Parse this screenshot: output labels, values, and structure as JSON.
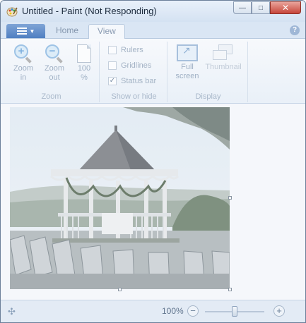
{
  "window": {
    "title": "Untitled - Paint (Not Responding)",
    "close_label": "✕",
    "maximize_label": "□",
    "minimize_label": "—"
  },
  "ribbon": {
    "tabs": [
      {
        "label": "Home",
        "active": false
      },
      {
        "label": "View",
        "active": true
      }
    ],
    "help_label": "?",
    "zoom_group": {
      "label": "Zoom",
      "zoom_in": {
        "line1": "Zoom",
        "line2": "in",
        "icon": "zoom-in-icon"
      },
      "zoom_out": {
        "line1": "Zoom",
        "line2": "out",
        "icon": "zoom-out-icon"
      },
      "hundred": {
        "line1": "100",
        "line2": "%",
        "icon": "page-icon"
      }
    },
    "show_hide_group": {
      "label": "Show or hide",
      "rulers": {
        "label": "Rulers",
        "checked": false
      },
      "gridlines": {
        "label": "Gridlines",
        "checked": false
      },
      "status_bar": {
        "label": "Status bar",
        "checked": true
      }
    },
    "display_group": {
      "label": "Display",
      "full_screen": {
        "line1": "Full",
        "line2": "screen",
        "icon": "full-screen-icon"
      },
      "thumbnail": {
        "label": "Thumbnail",
        "icon": "thumbnail-icon"
      }
    }
  },
  "statusbar": {
    "zoom_level": "100%",
    "zoom_out_symbol": "−",
    "zoom_in_symbol": "+",
    "zoom_fraction": 0.5
  },
  "canvas": {
    "image_subject": "gazebo-photo"
  }
}
